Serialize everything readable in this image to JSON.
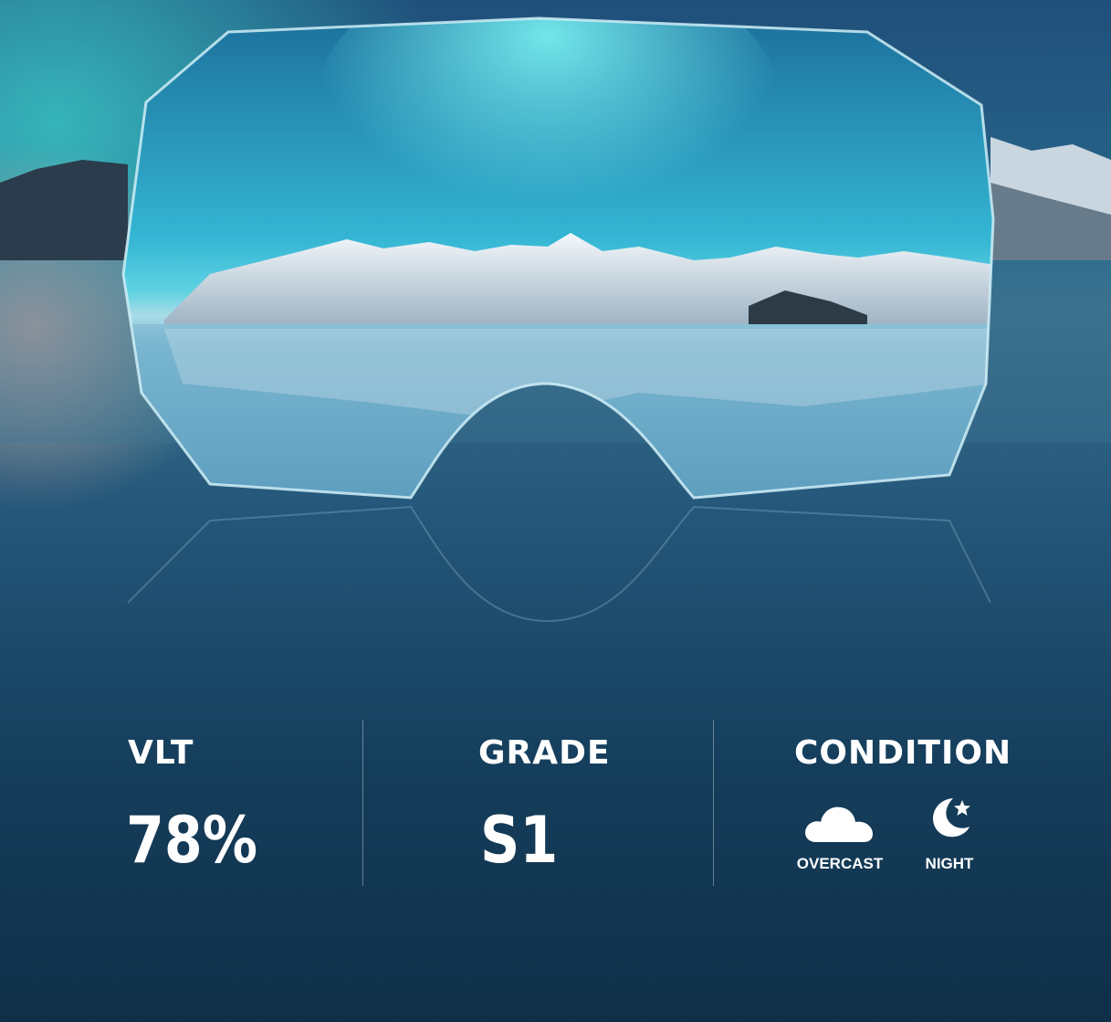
{
  "specs": {
    "vlt": {
      "label": "VLT",
      "value": "78%"
    },
    "grade": {
      "label": "GRADE",
      "value": "S1"
    },
    "condition": {
      "label": "CONDITION",
      "items": [
        {
          "icon": "cloud-icon",
          "caption": "OVERCAST"
        },
        {
          "icon": "moon-star-icon",
          "caption": "NIGHT"
        }
      ]
    }
  },
  "colors": {
    "text": "#ffffff",
    "sky_aurora": "#3fd0e0",
    "deep_water": "#0f2f48",
    "lens_edge": "#cfeff7"
  }
}
